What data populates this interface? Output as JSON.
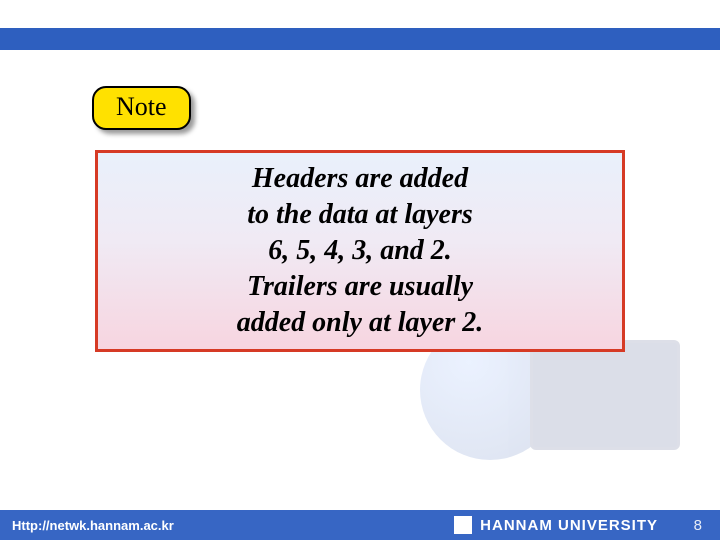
{
  "note": {
    "label": "Note"
  },
  "content": {
    "lines": [
      "Headers are added",
      "to the data at layers",
      "6, 5, 4, 3, and 2.",
      "Trailers are usually",
      "added only at layer 2."
    ]
  },
  "footer": {
    "url": "Http://netwk.hannam.ac.kr",
    "university": "HANNAM  UNIVERSITY",
    "page": "8"
  }
}
